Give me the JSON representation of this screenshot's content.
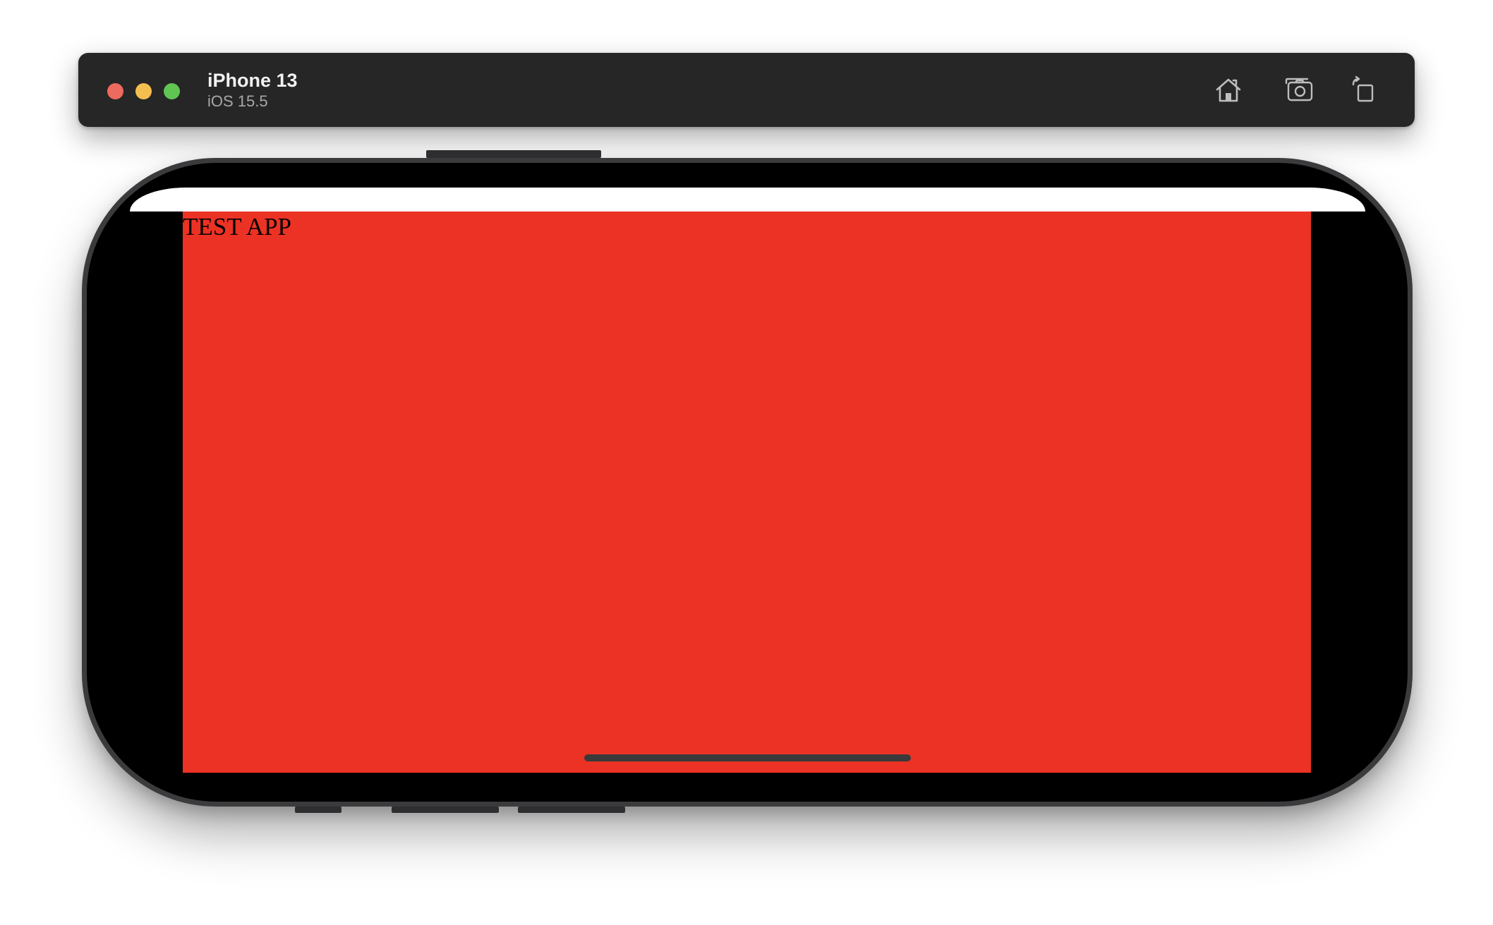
{
  "simulator": {
    "device_name": "iPhone 13",
    "os_version": "iOS 15.5",
    "traffic_lights": {
      "close_color": "#ed6a5e",
      "minimize_color": "#f5bf4f",
      "zoom_color": "#61c554"
    },
    "toolbar_buttons": [
      {
        "icon": "home-icon"
      },
      {
        "icon": "screenshot-icon"
      },
      {
        "icon": "rotate-icon"
      }
    ],
    "toolbar_color": "#262626"
  },
  "app": {
    "title": "TEST APP",
    "background_color": "#ec3224",
    "status_bar_color": "#ffffff"
  }
}
